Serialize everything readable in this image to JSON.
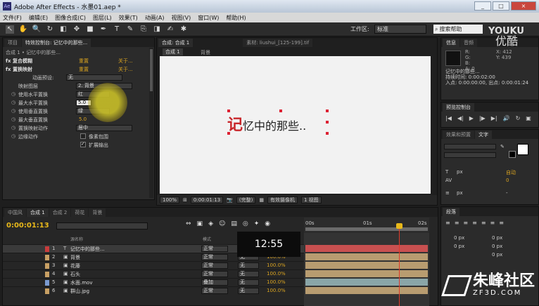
{
  "window": {
    "title": "Adobe After Effects - 水墨01.aep *",
    "app_icon": "Ae",
    "buttons": [
      "_",
      "□",
      "×"
    ]
  },
  "menu": [
    "文件(F)",
    "编辑(E)",
    "图像合成(C)",
    "图层(L)",
    "效果(T)",
    "动画(A)",
    "视图(V)",
    "窗口(W)",
    "帮助(H)"
  ],
  "toolbar": {
    "tools": [
      "selection-tool-icon",
      "hand-tool-icon",
      "zoom-tool-icon",
      "rotate-tool-icon",
      "camera-tool-icon",
      "pan-behind-tool-icon",
      "rectangle-tool-icon",
      "pen-tool-icon",
      "text-tool-icon",
      "brush-tool-icon",
      "clone-stamp-tool-icon",
      "eraser-tool-icon",
      "roto-brush-tool-icon",
      "puppet-tool-icon"
    ],
    "tool_glyphs": [
      "↖",
      "✋",
      "🔍",
      "↻",
      "◧",
      "✥",
      "■",
      "✒",
      "T",
      "✎",
      "⎘",
      "◨",
      "✍",
      "✱"
    ],
    "workspace_label": "工作区:",
    "workspace_value": "标准",
    "search_placeholder": "搜索帮助"
  },
  "effect_controls": {
    "tabs": [
      "项目",
      "特效控制台: 记忆中的那些..."
    ],
    "header": "合成 1 • 记忆中的那些...",
    "rows": [
      {
        "kind": "fx",
        "label": "fx 复合模糊",
        "value": "重置",
        "right": "关于..."
      },
      {
        "kind": "fx",
        "label": "fx 置换映射",
        "value": "重置",
        "right": "关于..."
      },
      {
        "kind": "text",
        "label": "动画预设:",
        "dropdown": "无"
      },
      {
        "kind": "dd",
        "label": "映射图层",
        "dropdown": "2. 背景"
      },
      {
        "kind": "dd",
        "label": "使用水平置换",
        "dropdown": "红"
      },
      {
        "kind": "num",
        "label": "最大水平置换",
        "value": "5.0"
      },
      {
        "kind": "dd",
        "label": "使用垂直置换",
        "dropdown": "绿"
      },
      {
        "kind": "num",
        "label": "最大垂直置换",
        "value": "5.0"
      },
      {
        "kind": "dd",
        "label": "置换映射动作",
        "dropdown": "居中"
      },
      {
        "kind": "cb",
        "label": "边缘动作",
        "checked": false,
        "cb_label": "像素包围"
      },
      {
        "kind": "cb",
        "label": "",
        "checked": true,
        "cb_label": "扩展输出"
      }
    ]
  },
  "composition": {
    "tabs": [
      "合成: 合成 1",
      "素材: liushui_[125-199].tif"
    ],
    "subtabs": [
      "合成 1",
      "背景"
    ],
    "text_first": "记",
    "text_rest": "忆中的那些..",
    "footer": {
      "zoom": "100%",
      "timecode": "0:00:01:13",
      "resolution": "(完整)",
      "camera": "有效摄像机",
      "views": "1 视图"
    }
  },
  "info": {
    "tabs": [
      "信息",
      "音频"
    ],
    "rgba": [
      "R:",
      "G:",
      "B:",
      "A: 0"
    ],
    "coords": [
      "X: 412",
      "Y: 439"
    ],
    "lines": [
      "记忆中的那些...",
      "持续时间: 0:00:02:00",
      "入点: 0:00:00:00, 出点: 0:00:01:24"
    ]
  },
  "preview": {
    "tabs": [
      "预览控制台"
    ],
    "buttons": [
      "|◀",
      "◀|",
      "▶",
      "|▶",
      "▶|",
      "🔊",
      "↻",
      "▣"
    ]
  },
  "character": {
    "tabs": [
      "效果和预置",
      "文字"
    ],
    "labels": {
      "size_unit": "px",
      "leading": "自动",
      "tracking": "0",
      "stroke_unit": "px",
      "stroke_mode": "-"
    }
  },
  "paragraph": {
    "tabs": [
      "段落"
    ],
    "values": [
      "0 px",
      "0 px",
      "0 px",
      "0 px",
      "0 px"
    ]
  },
  "timeline": {
    "tabs": [
      "中国风",
      "合成 1",
      "合成 2",
      "荷花",
      "背景"
    ],
    "current_time": "0:00:01:13",
    "header": {
      "name": "源名称",
      "mode": "模式",
      "parent": "父级"
    },
    "ruler": [
      "00s",
      "01s",
      "02s"
    ],
    "layers": [
      {
        "num": "1",
        "type": "T",
        "name": "记忆中的那些...",
        "mode": "正常",
        "parent": "无",
        "color": "#c83c3c",
        "selected": true,
        "pct": ""
      },
      {
        "num": "2",
        "type": "▣",
        "name": "背景",
        "mode": "正常",
        "parent": "无",
        "color": "#c8a064",
        "pct": "100.0%"
      },
      {
        "num": "3",
        "type": "▣",
        "name": "花藤",
        "mode": "正常",
        "parent": "无",
        "color": "#c8a064",
        "pct": "100.0%"
      },
      {
        "num": "4",
        "type": "▣",
        "name": "石头",
        "mode": "正常",
        "parent": "无",
        "color": "#c8a064",
        "pct": "100.0%"
      },
      {
        "num": "5",
        "type": "▣",
        "name": "水面.mov",
        "mode": "叠加",
        "parent": "无",
        "color": "#7a9ad0",
        "pct": "100.0%"
      },
      {
        "num": "6",
        "type": "▣",
        "name": "群山.jpg",
        "mode": "正常",
        "parent": "无",
        "color": "#c8a064",
        "pct": "100.0%"
      }
    ],
    "track_colors": [
      "#c85050",
      "#b89c70",
      "#b89c70",
      "#b89c70",
      "#8aa6a8",
      "#b89c70"
    ]
  },
  "overlay": {
    "video_time": "12:55",
    "logo_main": "YOUKU",
    "logo_sub": "优酷",
    "watermark_main": "朱峰社区",
    "watermark_sub": "ZF3D.COM"
  }
}
